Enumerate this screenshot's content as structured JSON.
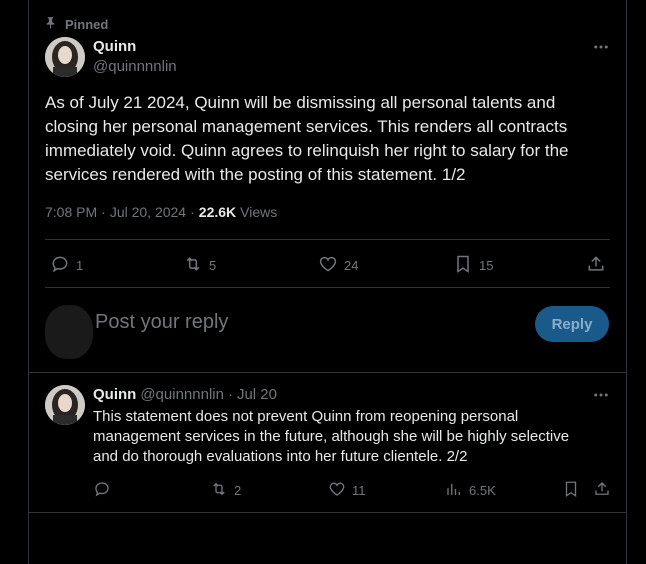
{
  "pinned_label": "Pinned",
  "tweet": {
    "author_name": "Quinn",
    "author_handle": "@quinnnnlin",
    "text": "As of July 21 2024, Quinn will be dismissing all personal talents and closing her personal management services. This renders all contracts immediately void. Quinn agrees to relinquish her right to salary for the services rendered with the posting of this statement. 1/2",
    "time": "7:08 PM",
    "date": "Jul 20, 2024",
    "separator": "·",
    "views_count": "22.6K",
    "views_label": "Views",
    "replies": "1",
    "retweets": "5",
    "likes": "24",
    "bookmarks": "15"
  },
  "composer": {
    "placeholder": "Post your reply",
    "button_label": "Reply"
  },
  "reply": {
    "author_name": "Quinn",
    "author_handle": "@quinnnnlin",
    "separator": "·",
    "date": "Jul 20",
    "text": "This statement does not prevent Quinn from reopening personal management services in the future, although she will be highly selective and do thorough evaluations into her future clientele. 2/2",
    "retweets": "2",
    "likes": "11",
    "views": "6.5K"
  },
  "icons": {
    "pin": "pin-icon",
    "more": "more-icon",
    "reply": "reply-icon",
    "retweet": "retweet-icon",
    "like": "heart-icon",
    "bookmark": "bookmark-icon",
    "share": "share-icon",
    "views": "views-icon"
  },
  "colors": {
    "background": "#000000",
    "text": "#e7e9ea",
    "muted": "#71767b",
    "border": "#2f3336",
    "reply_button": "#1a5a8a"
  }
}
